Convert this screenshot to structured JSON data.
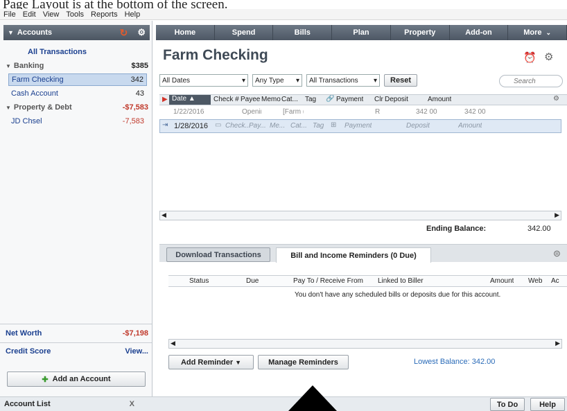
{
  "caption_top": "Page Layout is at the bottom of the screen.",
  "menu": [
    "File",
    "Edit",
    "View",
    "Tools",
    "Reports",
    "Help"
  ],
  "sidebar": {
    "header": "Accounts",
    "all_transactions": "All Transactions",
    "banking": {
      "label": "Banking",
      "total": "$385"
    },
    "accounts": [
      {
        "name": "Farm Checking",
        "balance": "342"
      },
      {
        "name": "Cash Account",
        "balance": "43"
      }
    ],
    "property": {
      "label": "Property & Debt",
      "total": "-$7,583"
    },
    "property_accounts": [
      {
        "name": "JD Chsel",
        "balance": "-7,583"
      }
    ],
    "net_worth": {
      "label": "Net Worth",
      "value": "-$7,198"
    },
    "credit_score": {
      "label": "Credit Score",
      "value": "View..."
    },
    "add_account": "Add an Account",
    "account_list": "Account List",
    "close_x": "X"
  },
  "nav_tabs": [
    "Home",
    "Spend",
    "Bills",
    "Plan",
    "Property",
    "Add-on",
    "More"
  ],
  "page_title": "Farm Checking",
  "filters": {
    "dates": "All Dates",
    "type": "Any Type",
    "transactions": "All Transactions",
    "reset": "Reset",
    "search_placeholder": "Search"
  },
  "columns": [
    "Date",
    "Check #",
    "Payee",
    "Memo",
    "Cat...",
    "Tag",
    "Payment",
    "Clr",
    "Deposit",
    "Amount"
  ],
  "rows": [
    {
      "date": "1/22/2016",
      "payee": "Openir",
      "category": "[Farm (",
      "clr": "R",
      "deposit": "342 00",
      "amount": "342 00"
    }
  ],
  "entry_row": {
    "date": "1/28/2016",
    "check": "Check...",
    "payee": "Pay...",
    "memo": "Me...",
    "category": "Cat...",
    "tag": "Tag",
    "payment": "Payment",
    "deposit": "Deposit",
    "amount": "Amount"
  },
  "ending_balance": {
    "label": "Ending Balance:",
    "value": "342.00"
  },
  "bottom_tabs": [
    "Download Transactions",
    "Bill and Income Reminders (0 Due)"
  ],
  "reminder_columns": [
    "Status",
    "Due",
    "Pay To / Receive From",
    "Linked to Biller",
    "Amount",
    "Web",
    "Ac"
  ],
  "empty_message": "You don't have any scheduled bills or deposits due for this account.",
  "add_reminder": "Add Reminder",
  "manage_reminders": "Manage Reminders",
  "lowest_balance": "Lowest Balance: 342.00",
  "status_buttons": [
    "To Do",
    "Help"
  ]
}
